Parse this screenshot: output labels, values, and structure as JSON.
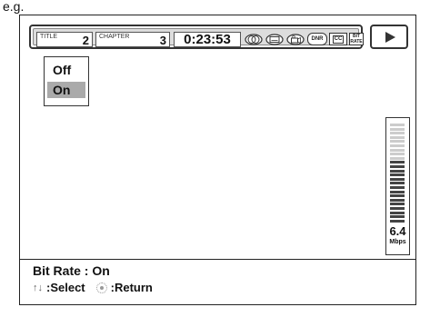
{
  "caption": "e.g.",
  "info_bar": {
    "title_label": "TITLE",
    "title_value": "2",
    "chapter_label": "CHAPTER",
    "chapter_value": "3",
    "time": "0:23:53",
    "icons": [
      "audio-icon",
      "subtitle-icon",
      "angle-icon",
      "dnr-icon",
      "cc-icon",
      "bit-rate-icon"
    ],
    "dnr_label": "DNR",
    "cc_label": "CC",
    "bitrate_label_1": "BIT",
    "bitrate_label_2": "RATE"
  },
  "menu": {
    "options": [
      "Off",
      "On"
    ],
    "selected": "On"
  },
  "meter": {
    "value": "6.4",
    "unit": "Mbps",
    "level_fraction": 0.64
  },
  "status": {
    "line1": "Bit Rate : On",
    "select_label": ":Select",
    "return_label": ":Return"
  }
}
